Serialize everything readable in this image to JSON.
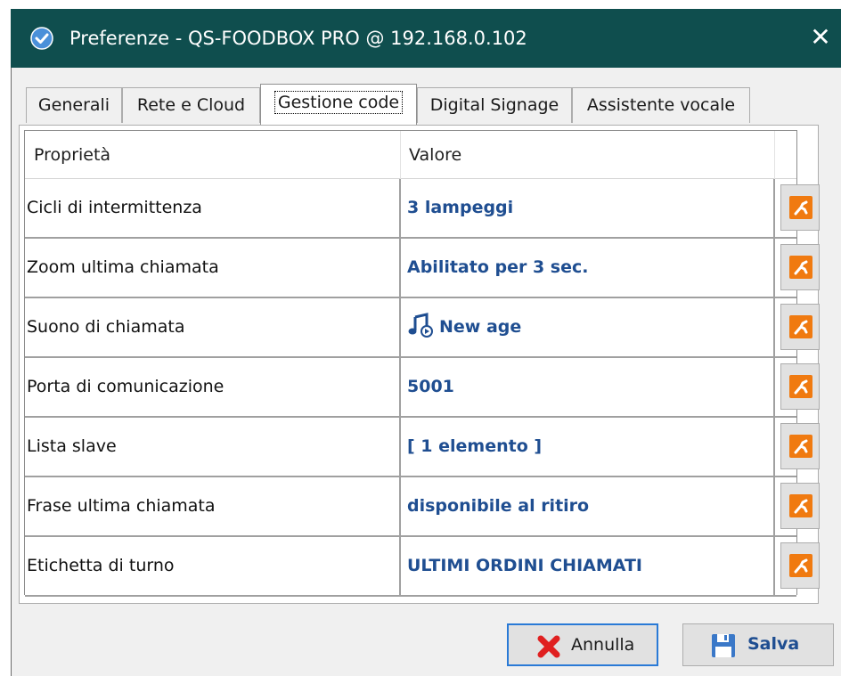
{
  "window": {
    "title": "Preferenze - QS-FOODBOX PRO @ 192.168.0.102",
    "close_glyph": "✕"
  },
  "tabs": [
    {
      "label": "Generali",
      "active": false
    },
    {
      "label": "Rete e Cloud",
      "active": false
    },
    {
      "label": "Gestione code",
      "active": true
    },
    {
      "label": "Digital Signage",
      "active": false
    },
    {
      "label": "Assistente vocale",
      "active": false
    }
  ],
  "grid": {
    "headers": {
      "property": "Proprietà",
      "value": "Valore"
    },
    "rows": [
      {
        "property": "Cicli di intermittenza",
        "value": "3 lampeggi"
      },
      {
        "property": "Zoom ultima chiamata",
        "value": "Abilitato per 3 sec."
      },
      {
        "property": "Suono di chiamata",
        "value": "New age",
        "icon": "music-note-icon"
      },
      {
        "property": "Porta di comunicazione",
        "value": "5001"
      },
      {
        "property": "Lista slave",
        "value": "[ 1 elemento ]"
      },
      {
        "property": "Frase ultima chiamata",
        "value": "disponibile al ritiro"
      },
      {
        "property": "Etichetta di turno",
        "value": "ULTIMI ORDINI CHIAMATI"
      }
    ],
    "edit_icon": "wrench-edit-icon"
  },
  "footer": {
    "cancel_label": "Annulla",
    "cancel_icon": "red-x-icon",
    "save_label": "Salva",
    "save_icon": "floppy-disk-icon"
  },
  "colors": {
    "titlebar": "#0f4e4e",
    "value_text": "#1f4e91",
    "edit_icon": "#f07a10",
    "focus_border": "#2a7ad6"
  }
}
